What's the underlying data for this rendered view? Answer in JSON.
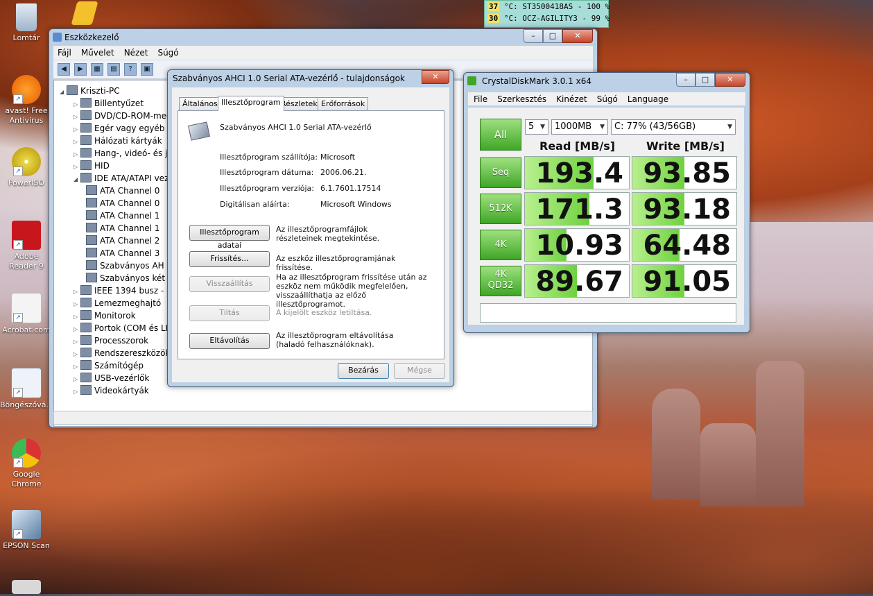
{
  "desktop": {
    "icons": [
      {
        "label": "Lomtár"
      },
      {
        "label": "avast! Free Antivirus"
      },
      {
        "label": "PowerISO"
      },
      {
        "label": "Adobe Reader 9"
      },
      {
        "label": "Acrobat.com"
      },
      {
        "label": "Böngészővá..."
      },
      {
        "label": "Google Chrome"
      },
      {
        "label": "EPSON Scan"
      }
    ]
  },
  "temps": [
    {
      "value": "37",
      "text": "°C: ST3500418AS - 100 %"
    },
    {
      "value": "30",
      "text": "°C: OCZ-AGILITY3 - 99 %"
    }
  ],
  "device_manager": {
    "title": "Eszközkezelő",
    "menu": [
      "Fájl",
      "Művelet",
      "Nézet",
      "Súgó"
    ],
    "tree": {
      "root": "Kriszti-PC",
      "items": [
        "Billentyűzet",
        "DVD/CD-ROM-meg",
        "Egér vagy egyéb m",
        "Hálózati kártyák",
        "Hang-, videó- és já",
        "HID",
        "IDE ATA/ATAPI vez",
        "ATA Channel 0",
        "ATA Channel 0",
        "ATA Channel 1",
        "ATA Channel 1",
        "ATA Channel 2",
        "ATA Channel 3",
        "Szabványos AH",
        "Szabványos két",
        "IEEE 1394 busz - áll",
        "Lemezmeghajtó",
        "Monitorok",
        "Portok (COM és LP",
        "Processzorok",
        "Rendszereszközök",
        "Számítógép",
        "USB-vezérlők",
        "Videokártyák"
      ]
    }
  },
  "properties": {
    "title": "Szabványos AHCI 1.0 Serial ATA-vezérlő - tulajdonságok",
    "tabs": [
      "Általános",
      "Illesztőprogram",
      "Részletek",
      "Erőforrások"
    ],
    "device_name": "Szabványos AHCI 1.0 Serial ATA-vezérlő",
    "fields": [
      {
        "label": "Illesztőprogram szállítója:",
        "value": "Microsoft"
      },
      {
        "label": "Illesztőprogram dátuma:",
        "value": "2006.06.21."
      },
      {
        "label": "Illesztőprogram verziója:",
        "value": "6.1.7601.17514"
      },
      {
        "label": "Digitálisan aláírta:",
        "value": "Microsoft Windows"
      }
    ],
    "actions": [
      {
        "button": "Illesztőprogram adatai",
        "desc": "Az illesztőprogramfájlok részleteinek megtekintése."
      },
      {
        "button": "Frissítés...",
        "desc": "Az eszköz illesztőprogramjának frissítése."
      },
      {
        "button": "Visszaállítás",
        "desc": "Ha az illesztőprogram frissítése után az eszköz nem működik megfelelően, visszaállíthatja az előző illesztőprogramot."
      },
      {
        "button": "Tiltás",
        "desc": "A kijelölt eszköz letiltása."
      },
      {
        "button": "Eltávolítás",
        "desc": "Az illesztőprogram eltávolítása (haladó felhasználóknak)."
      }
    ],
    "ok": "Bezárás",
    "cancel": "Mégse"
  },
  "cdm": {
    "title": "CrystalDiskMark 3.0.1 x64",
    "menu": [
      "File",
      "Szerkesztés",
      "Kinézet",
      "Súgó",
      "Language"
    ],
    "all_label": "All",
    "runs": "5",
    "size": "1000MB",
    "drive": "C: 77% (43/56GB)",
    "read_header": "Read [MB/s]",
    "write_header": "Write [MB/s]",
    "rows": [
      {
        "label": "Seq",
        "read": "193.4",
        "write": "93.85",
        "read_fill": 0.66,
        "write_fill": 0.5
      },
      {
        "label": "512K",
        "read": "171.3",
        "write": "93.18",
        "read_fill": 0.62,
        "write_fill": 0.5
      },
      {
        "label": "4K",
        "read": "10.93",
        "write": "64.48",
        "read_fill": 0.4,
        "write_fill": 0.45
      },
      {
        "label_line1": "4K",
        "label_line2": "QD32",
        "read": "89.67",
        "write": "91.05",
        "read_fill": 0.5,
        "write_fill": 0.5
      }
    ]
  }
}
